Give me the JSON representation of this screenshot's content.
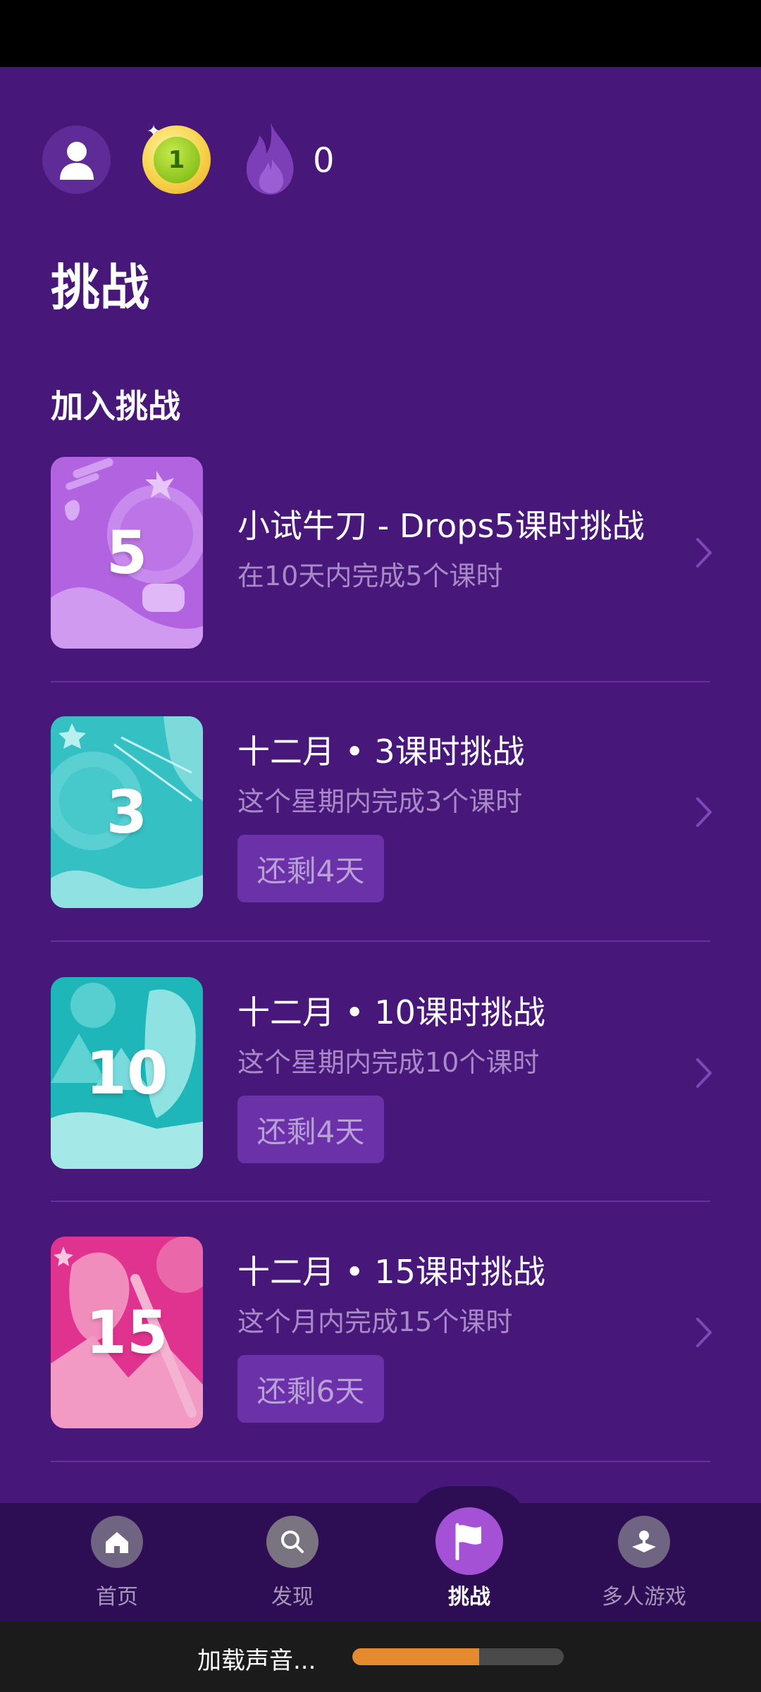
{
  "header": {
    "level": "1",
    "streak_count": "0"
  },
  "page_title": "挑战",
  "section_title": "加入挑战",
  "challenges": [
    {
      "card_number": "5",
      "title": "小试牛刀 - Drops5课时挑战",
      "description": "在10天内完成5个课时",
      "remaining": "",
      "card_color": "#b264e0"
    },
    {
      "card_number": "3",
      "title": "十二月 • 3课时挑战",
      "description": "这个星期内完成3个课时",
      "remaining": "还剩4天",
      "card_color": "#35c1c4"
    },
    {
      "card_number": "10",
      "title": "十二月 • 10课时挑战",
      "description": "这个星期内完成10个课时",
      "remaining": "还剩4天",
      "card_color": "#3fc7c8"
    },
    {
      "card_number": "15",
      "title": "十二月 • 15课时挑战",
      "description": "这个月内完成15个课时",
      "remaining": "还剩6天",
      "card_color": "#e0338f"
    }
  ],
  "nav": {
    "items": [
      {
        "label": "首页",
        "icon": "home-icon"
      },
      {
        "label": "发现",
        "icon": "search-icon"
      },
      {
        "label": "挑战",
        "icon": "flag-icon",
        "active": true
      },
      {
        "label": "多人游戏",
        "icon": "joystick-icon"
      }
    ]
  },
  "loading": {
    "text": "加载声音...",
    "progress": 0.6
  },
  "colors": {
    "background": "#48177a",
    "accent": "#a451d6",
    "progress": "#e58a2e"
  }
}
